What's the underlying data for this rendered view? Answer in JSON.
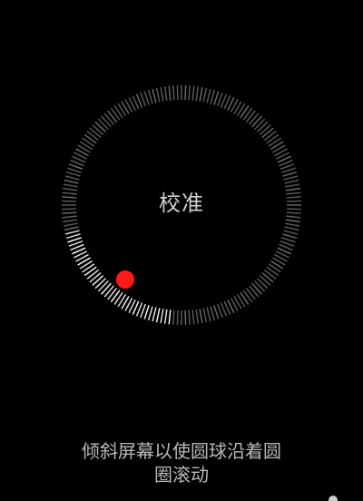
{
  "calibration": {
    "title": "校准",
    "instruction_line1": "倾斜屏幕以使圆球沿着圆",
    "instruction_line2": "圈滚动",
    "progress_fraction": 0.2,
    "colors": {
      "background": "#000000",
      "tick_inactive": "#7a7a7a",
      "tick_active": "#ffffff",
      "ball": "#ff1a1a",
      "text": "#cfcfcf"
    },
    "icons": {
      "ball": "red-ball-indicator"
    }
  }
}
